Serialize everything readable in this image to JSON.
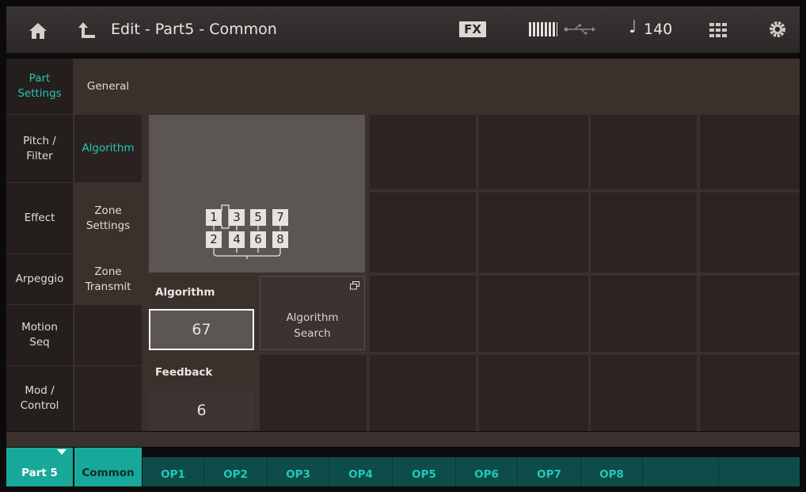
{
  "header": {
    "title": "Edit - Part5 - Common",
    "fx_label": "FX",
    "tempo": "140",
    "tempo_symbol": "♩",
    "icons": [
      "home-icon",
      "back-arrow-icon",
      "keyboard-icon",
      "usb-icon",
      "grid-icon",
      "gear-icon"
    ]
  },
  "left_nav": {
    "col1": [
      {
        "label": "Part\nSettings",
        "selected": true
      },
      {
        "label": "Pitch /\nFilter",
        "selected": false
      },
      {
        "label": "Effect",
        "selected": false
      },
      {
        "label": "Arpeggio",
        "selected": false
      },
      {
        "label": "Motion\nSeq",
        "selected": false
      },
      {
        "label": "Mod /\nControl",
        "selected": false
      }
    ],
    "col2": [
      {
        "label": "General",
        "selected": false
      },
      {
        "label": "Algorithm",
        "selected": true
      },
      {
        "label": "Zone\nSettings",
        "selected": false
      },
      {
        "label": "Zone\nTransmit",
        "selected": false
      }
    ]
  },
  "algorithm_diagram": {
    "operators_top": [
      "1",
      "3",
      "5",
      "7"
    ],
    "operators_bottom": [
      "2",
      "4",
      "6",
      "8"
    ]
  },
  "params": {
    "algorithm_label": "Algorithm",
    "algorithm_value": "67",
    "search_button": "Algorithm\nSearch",
    "feedback_label": "Feedback",
    "feedback_value": "6"
  },
  "bottom_tabs": {
    "part": "Part 5",
    "common": "Common",
    "ops": [
      "OP1",
      "OP2",
      "OP3",
      "OP4",
      "OP5",
      "OP6",
      "OP7",
      "OP8"
    ]
  },
  "colors": {
    "accent": "#23c8b6",
    "tab_bg": "#18a899",
    "op_bar": "#0d4c49",
    "background": "#0c0b0b"
  }
}
